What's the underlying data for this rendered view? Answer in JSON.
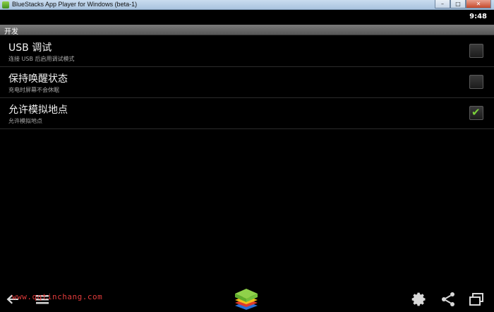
{
  "window": {
    "title": "BlueStacks App Player for Windows (beta-1)",
    "minimize_glyph": "–",
    "maximize_glyph": "□",
    "close_glyph": "✕"
  },
  "status_bar": {
    "time": "9:48"
  },
  "section": {
    "title": "开发"
  },
  "settings": [
    {
      "title": "USB 调试",
      "summary": "连接 USB 后启用调试模式",
      "checked": false
    },
    {
      "title": "保持唤醒状态",
      "summary": "充电时屏幕不会休眠",
      "checked": false
    },
    {
      "title": "允许模拟地点",
      "summary": "允许模拟地点",
      "checked": true
    }
  ],
  "navbar": {
    "icons": [
      "back-icon",
      "menu-icon",
      "bluestacks-logo",
      "settings-gear-icon",
      "share-icon",
      "window-toggle-icon"
    ]
  },
  "watermark": "www.qqtinchang.com",
  "colors": {
    "check_accent": "#7bd13a",
    "header_gray": "#6b6b6b"
  }
}
